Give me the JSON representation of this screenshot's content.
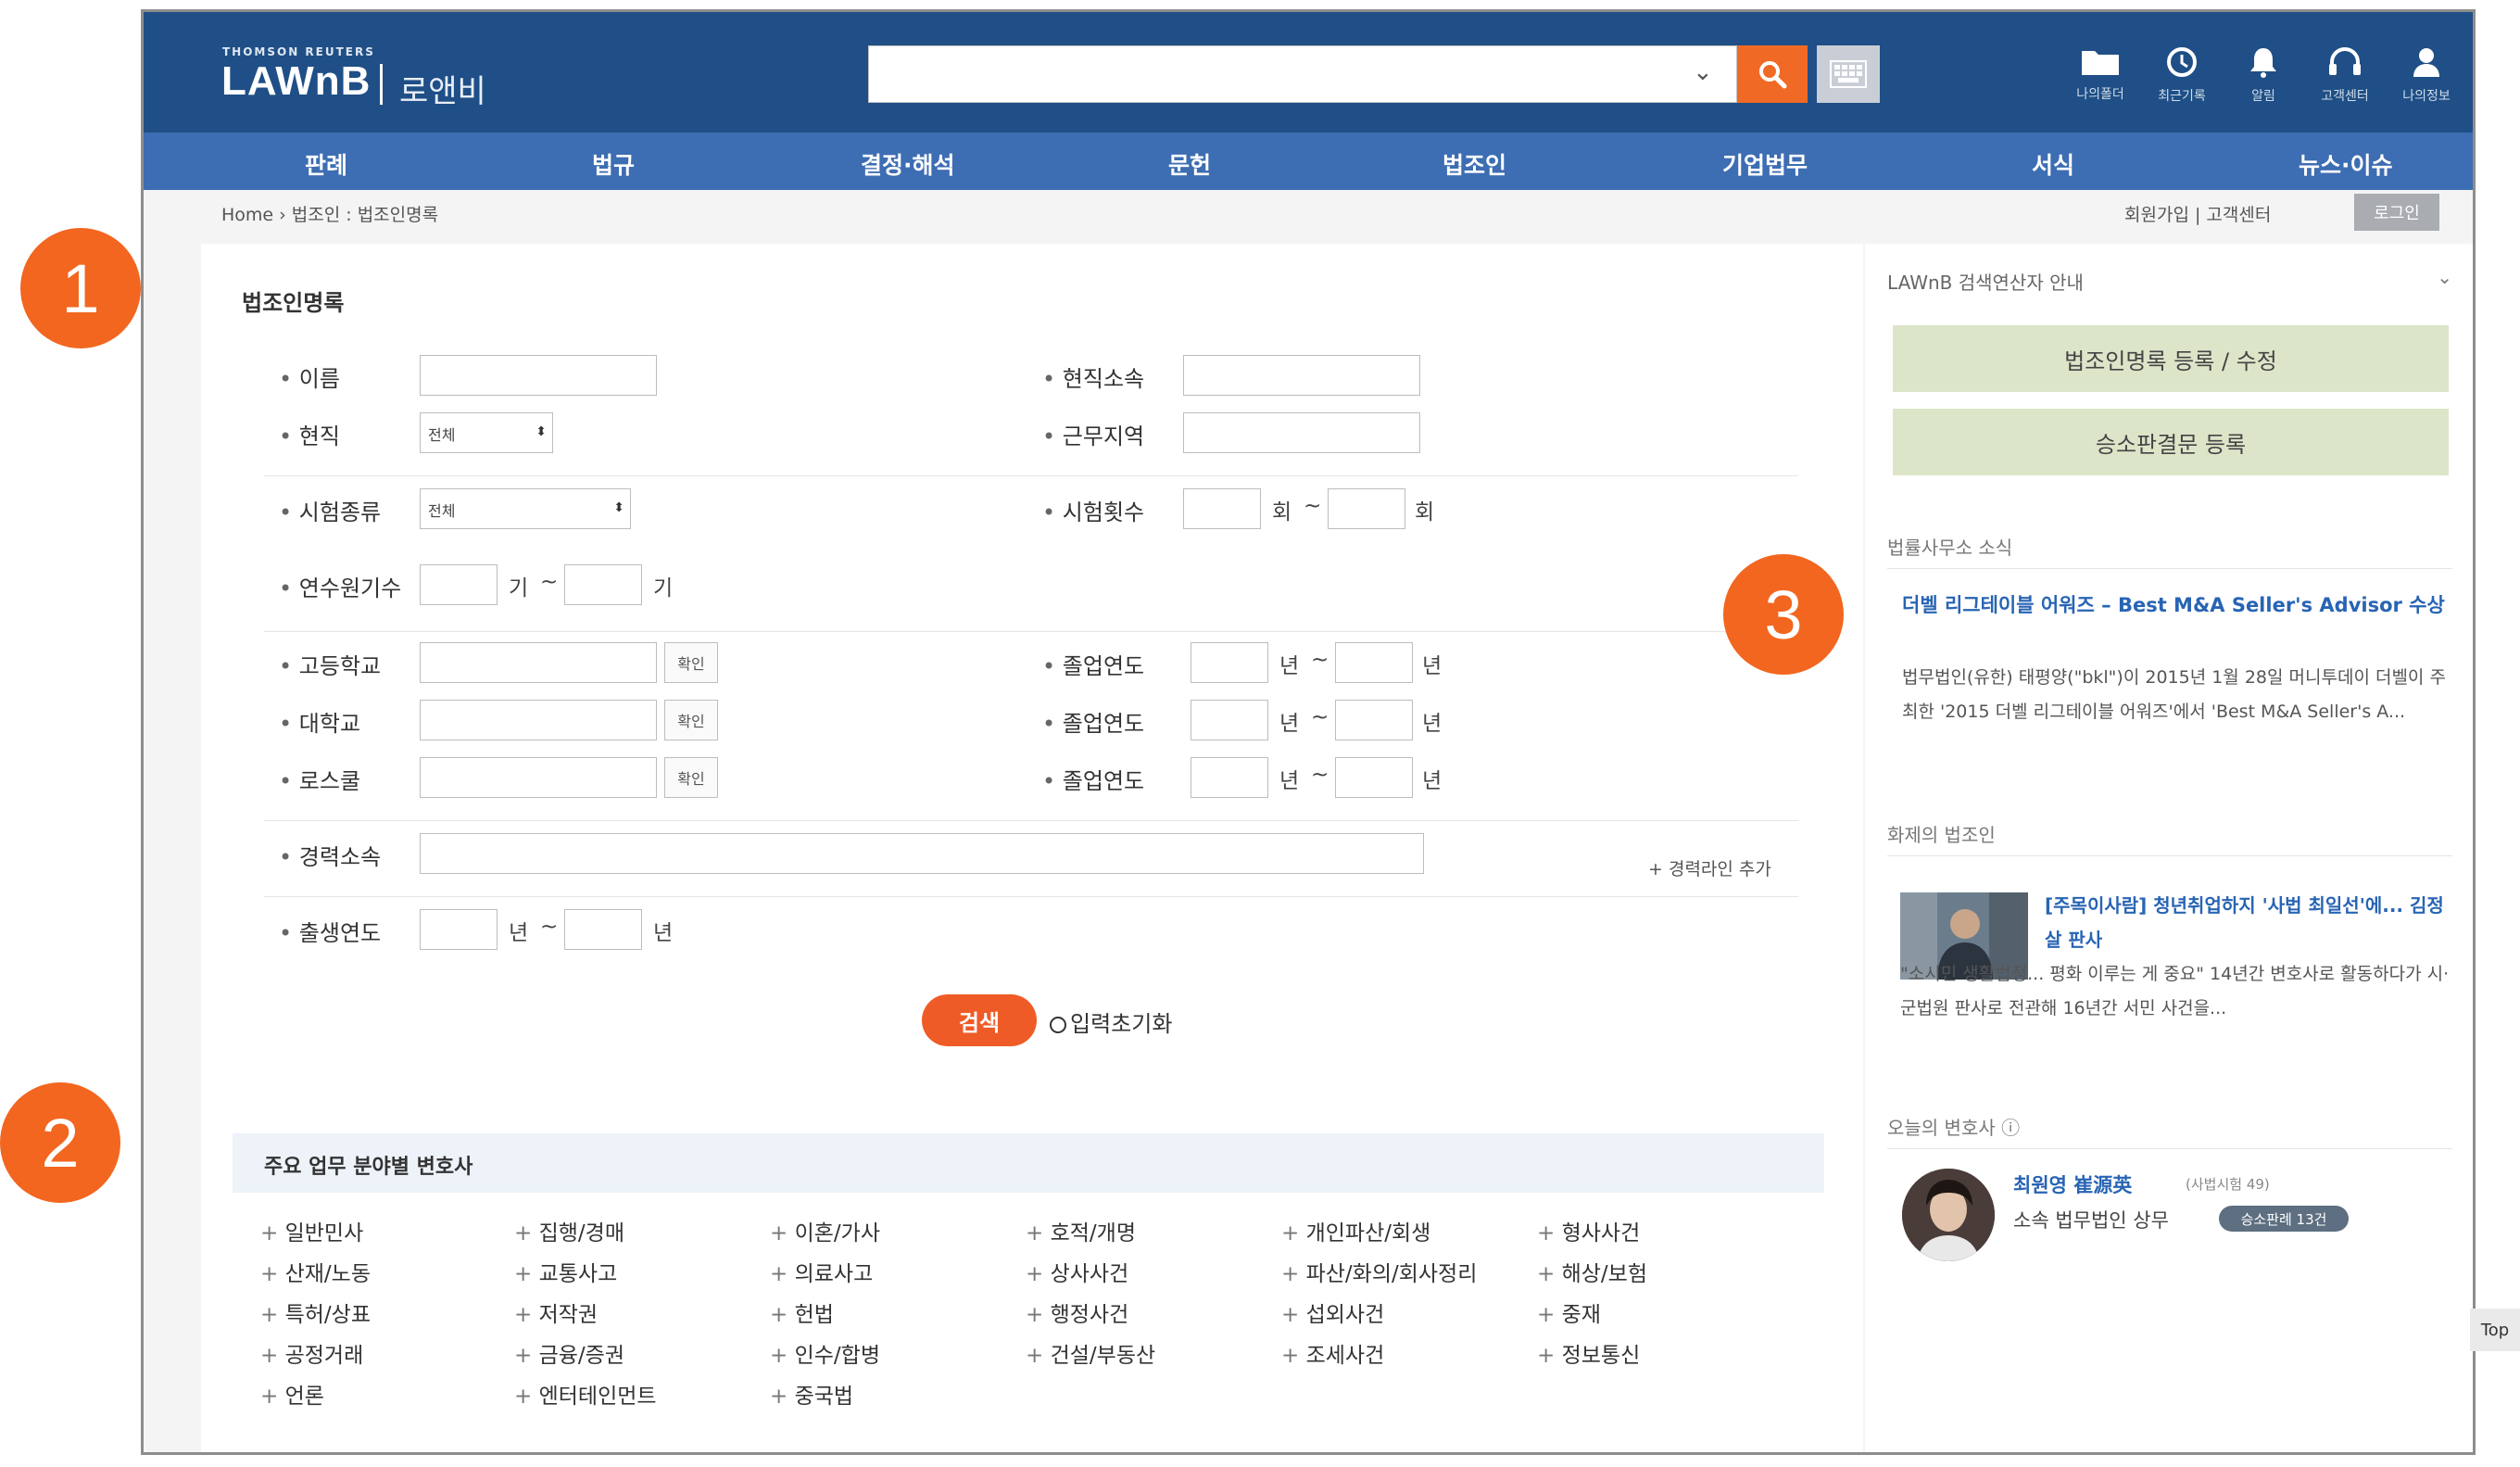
{
  "header": {
    "brand_small": "THOMSON REUTERS",
    "brand": "LAWnB",
    "brand_ko": "로앤비",
    "icons": [
      {
        "icon": "folder-icon",
        "label": "나의폴더"
      },
      {
        "icon": "history-icon",
        "label": "최근기록"
      },
      {
        "icon": "bell-icon",
        "label": "알림"
      },
      {
        "icon": "headset-icon",
        "label": "고객센터"
      },
      {
        "icon": "user-icon",
        "label": "나의정보"
      }
    ]
  },
  "nav": [
    "판례",
    "법규",
    "결정·해석",
    "문헌",
    "법조인",
    "기업법무",
    "서식",
    "뉴스·이슈"
  ],
  "breadcrumb": "Home  ›  법조인 : 법조인명록",
  "toplinks": "회원가입   |   고객센터",
  "login": "로그인",
  "form": {
    "title": "법조인명록",
    "labels": {
      "name": "이름",
      "affiliation": "현직소속",
      "position": "현직",
      "region": "근무지역",
      "exam_type": "시험종류",
      "exam_round": "시험횟수",
      "training": "연수원기수",
      "highschool": "고등학교",
      "grad1": "졸업연도",
      "university": "대학교",
      "grad2": "졸업연도",
      "lawschool": "로스쿨",
      "grad3": "졸업연도",
      "career": "경력소속",
      "birth": "출생연도"
    },
    "position_value": "전체",
    "exam_type_value": "전체",
    "units": {
      "round": "회",
      "term": "기",
      "year": "년",
      "range": "~"
    },
    "confirm": "확인",
    "add_career": "+ 경력라인 추가",
    "search_btn": "검색",
    "reset": "입력초기화"
  },
  "specialties": {
    "title": "주요 업무 분야별 변호사",
    "columns": [
      [
        "일반민사",
        "산재/노동",
        "특허/상표",
        "공정거래",
        "언론"
      ],
      [
        "집행/경매",
        "교통사고",
        "저작권",
        "금융/증권",
        "엔터테인먼트"
      ],
      [
        "이혼/가사",
        "의료사고",
        "헌법",
        "인수/합병",
        "중국법"
      ],
      [
        "호적/개명",
        "상사사건",
        "행정사건",
        "건설/부동산"
      ],
      [
        "개인파산/회생",
        "파산/화의/회사정리",
        "섭외사건",
        "조세사건"
      ],
      [
        "형사사건",
        "해상/보험",
        "중재",
        "정보통신"
      ]
    ]
  },
  "sidebar": {
    "operators": "LAWnB 검색연산자 안내",
    "btn_register": "법조인명록 등록 / 수정",
    "btn_ruling": "승소판결문 등록",
    "news_heading": "법률사무소 소식",
    "news_title": "더벨 리그테이블 어워즈 – Best M&A Seller's Advisor 수상",
    "news_body": "법무법인(유한) 태평양(\"bkl\")이 2015년 1월 28일 머니투데이 더벨이 주최한 '2015 더벨 리그테이블 어워즈'에서 'Best M&A Seller's A...",
    "issue_heading": "화제의 법조인",
    "issue_title": "[주목이사람] 청년취업하지 '사법 최일선'에... 김정살 판사",
    "issue_body": "\"소시민 생활법정... 평화 이루는 게 중요\" 14년간 변호사로 활동하다가 시·군법원 판사로 전관해 16년간 서민 사건을...",
    "today_heading": "오늘의 변호사 ⓘ",
    "lawyer_name": "최원영 崔源英",
    "lawyer_sub": "(사법시험 49)",
    "lawyer_firm": "소속  법무법인 상무",
    "lawyer_badge": "승소판례 13건"
  },
  "top_btn": "Top",
  "markers": [
    "1",
    "2",
    "3"
  ]
}
